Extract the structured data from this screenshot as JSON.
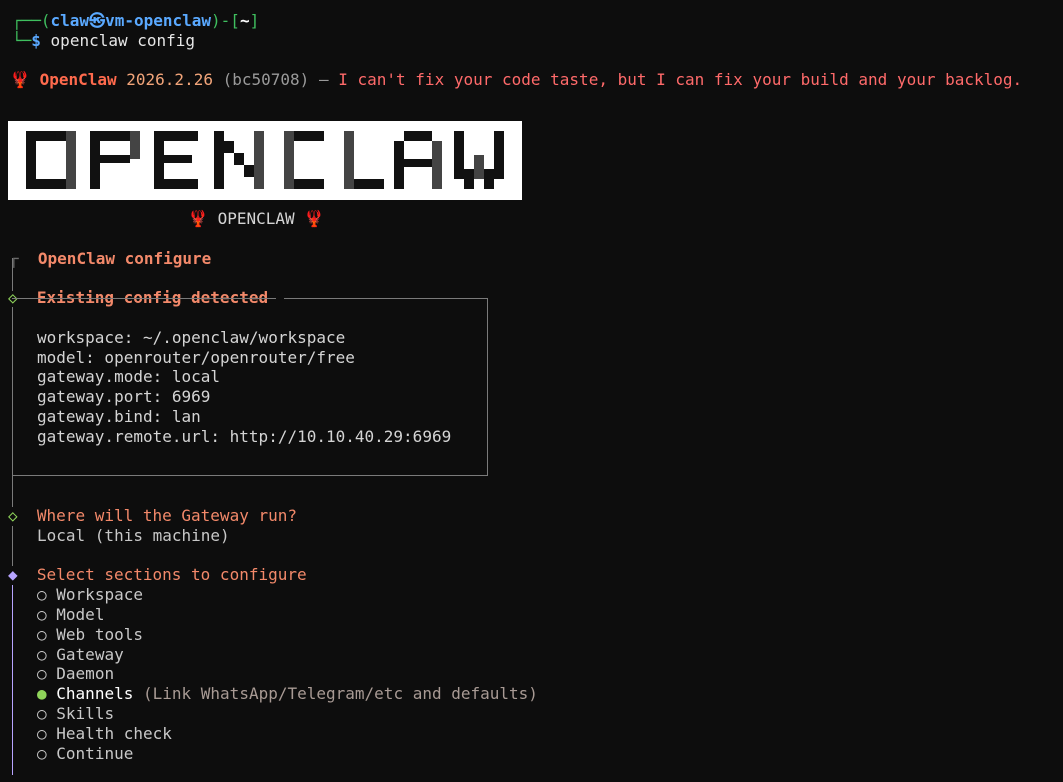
{
  "prompt": {
    "frame_top": "┌──(",
    "user": "claw㉿vm-openclaw",
    "frame_mid": ")-[",
    "path": "~",
    "frame_end": "]",
    "frame_bottom": "└─",
    "dollar": "$",
    "command": "openclaw config"
  },
  "banner": {
    "icon": "lobster-icon",
    "brand": "OpenClaw",
    "version": "2026.2.26",
    "hash": "(bc50708)",
    "dash": "—",
    "tagline": "I can't fix your code taste, but I can fix your build and your backlog."
  },
  "logo": {
    "text": "OPENCLAW",
    "caption": "OPENCLAW"
  },
  "sections": {
    "configure_title": "OpenClaw configure",
    "existing_title": "Existing config detected",
    "config_lines": [
      "workspace: ~/.openclaw/workspace",
      "model: openrouter/openrouter/free",
      "gateway.mode: local",
      "gateway.port: 6969",
      "gateway.bind: lan",
      "gateway.remote.url: http://10.10.40.29:6969"
    ],
    "gateway_question": "Where will the Gateway run?",
    "gateway_answer": "Local (this machine)",
    "select_title": "Select sections to configure",
    "options": [
      {
        "label": "Workspace",
        "hint": "",
        "selected": false
      },
      {
        "label": "Model",
        "hint": "",
        "selected": false
      },
      {
        "label": "Web tools",
        "hint": "",
        "selected": false
      },
      {
        "label": "Gateway",
        "hint": "",
        "selected": false
      },
      {
        "label": "Daemon",
        "hint": "",
        "selected": false
      },
      {
        "label": "Channels",
        "hint": "(Link WhatsApp/Telegram/etc and defaults)",
        "selected": true
      },
      {
        "label": "Skills",
        "hint": "",
        "selected": false
      },
      {
        "label": "Health check",
        "hint": "",
        "selected": false
      },
      {
        "label": "Continue",
        "hint": "",
        "selected": false
      }
    ]
  },
  "colors": {
    "background": "#0d0d0d",
    "accent": "#f3896a",
    "selected_dot": "#8fd45a",
    "active_diamond": "#b7a4ff"
  }
}
